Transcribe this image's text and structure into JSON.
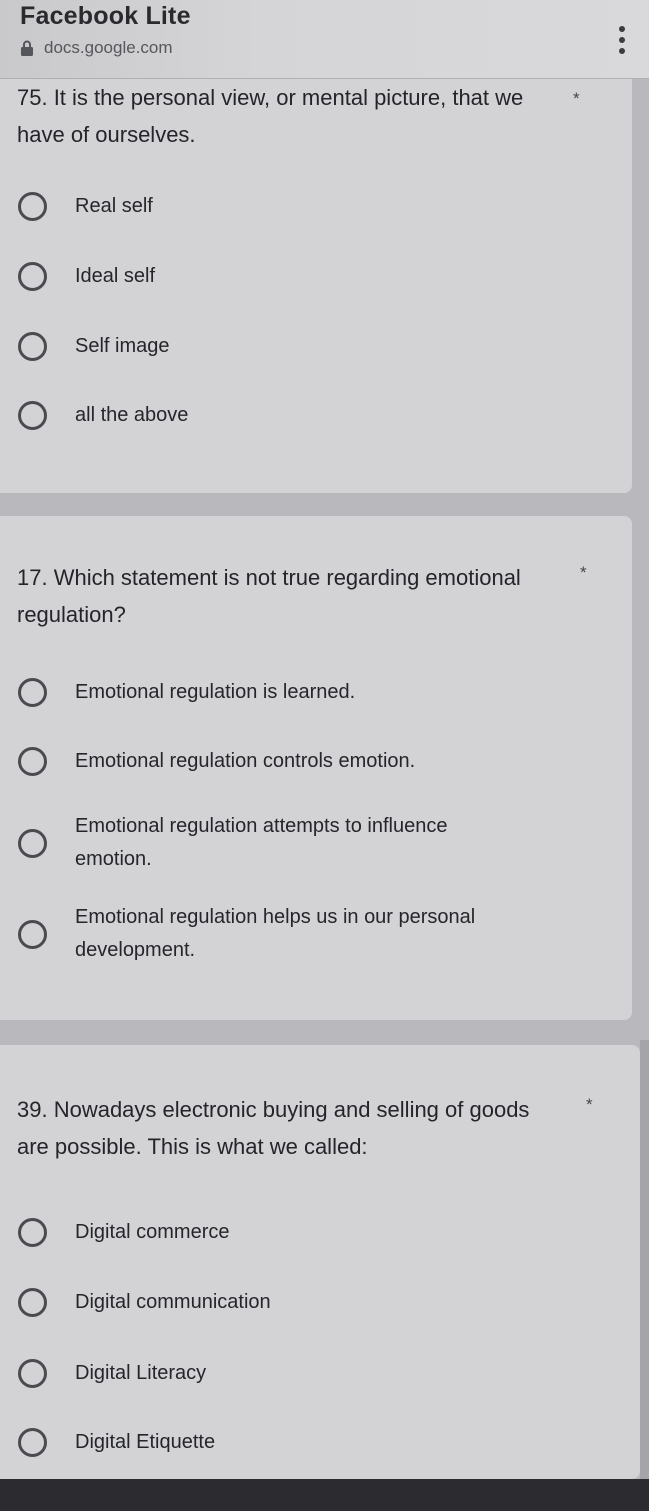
{
  "header": {
    "app_title": "Facebook Lite",
    "url": "docs.google.com",
    "lock_icon": "lock-icon",
    "menu_icon": "more-vert-icon"
  },
  "questions": [
    {
      "text": "75. It is the personal view, or mental picture, that we have of ourselves.",
      "required_mark": "*",
      "options": [
        "Real self",
        "Ideal self",
        "Self image",
        "all the above"
      ]
    },
    {
      "text": "17. Which statement is not true regarding emotional regulation?",
      "required_mark": "*",
      "options": [
        "Emotional regulation is learned.",
        "Emotional regulation controls emotion.",
        "Emotional regulation attempts to influence emotion.",
        "Emotional regulation helps us in our personal development."
      ]
    },
    {
      "text": "39. Nowadays electronic buying and selling of goods are possible. This is what we called:",
      "required_mark": "*",
      "options": [
        "Digital commerce",
        "Digital communication",
        "Digital Literacy",
        "Digital Etiquette"
      ]
    }
  ]
}
